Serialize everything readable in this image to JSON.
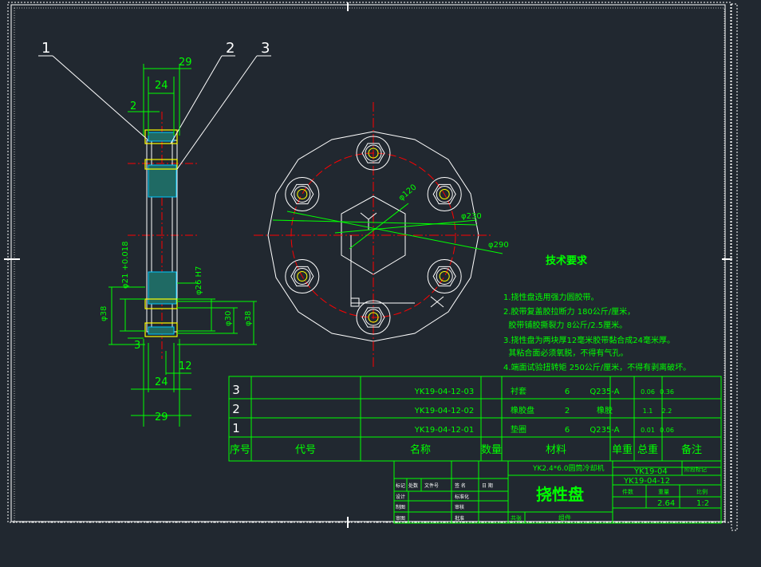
{
  "drawing": {
    "part_name": "挠性盘",
    "assembly_name": "YK2.4*6.0圆筒冷却机",
    "drawing_code": "YK19-04",
    "part_code": "YK19-04-12",
    "mass": "2.64",
    "scale": "1:2",
    "sheet_label_left": "共张",
    "sheet_label_right": "组件",
    "stage_mark": "阶段标记",
    "mass_label": "重量",
    "scale_label": "比例",
    "piece_label": "件数"
  },
  "title_block_left": {
    "row1": [
      "标记",
      "处数",
      "文件号",
      "签 名",
      "日 期"
    ],
    "row2": "设计",
    "row2b": "标准化",
    "row3": "制图",
    "row3b": "审核",
    "row4": "审图",
    "row4b": "批准",
    "row5": "工艺",
    "row5b": "日期"
  },
  "bom": {
    "headers": [
      "序号",
      "代号",
      "名称",
      "数量",
      "材料",
      "单重",
      "总重",
      "备注"
    ],
    "rows": [
      {
        "no": "3",
        "code": "YK19-04-12-03",
        "name": "衬套",
        "qty": "6",
        "material": "Q235-A",
        "unit": "0.06",
        "total": "0.36",
        "note": ""
      },
      {
        "no": "2",
        "code": "YK19-04-12-02",
        "name": "橡胶盘",
        "qty": "2",
        "material": "橡胶",
        "unit": "1.1",
        "total": "2.2",
        "note": ""
      },
      {
        "no": "1",
        "code": "YK19-04-12-01",
        "name": "垫圈",
        "qty": "6",
        "material": "Q235-A",
        "unit": "0.01",
        "total": "0.06",
        "note": ""
      }
    ]
  },
  "tech_req": {
    "title": "技术要求",
    "lines": [
      "1.挠性盘选用强力圆胶带。",
      "2.胶带复盖胶拉断力 180公斤/厘米，",
      "  胶带铺胶撕裂力 8公斤/2.5厘米。",
      "3.挠性盘为两块厚12毫米胶带黏合成24毫米厚。",
      "  其粘合面必须氧脱，不得有气孔。",
      "4.端面试验扭转矩 250公斤/厘米，不得有剥离破坏。"
    ]
  },
  "dims": {
    "d29_top": "29",
    "d24_top": "24",
    "d2": "2",
    "d29_bot": "29",
    "d24_bot": "24",
    "d12": "12",
    "d3": "3",
    "phi21": "φ21 +0.018",
    "phi26": "φ26 H7",
    "phi30": "φ30",
    "phi38_left": "φ38",
    "phi38_right": "φ38",
    "phi120": "φ120",
    "phi230": "φ230",
    "phi290": "φ290"
  },
  "callouts": [
    "1",
    "2",
    "3"
  ],
  "colors": {
    "bg": "#212830",
    "white": "#ffffff",
    "green": "#00ff00",
    "red": "#ff0000",
    "cyan": "#00c8ff",
    "yellow": "#ffff00"
  }
}
